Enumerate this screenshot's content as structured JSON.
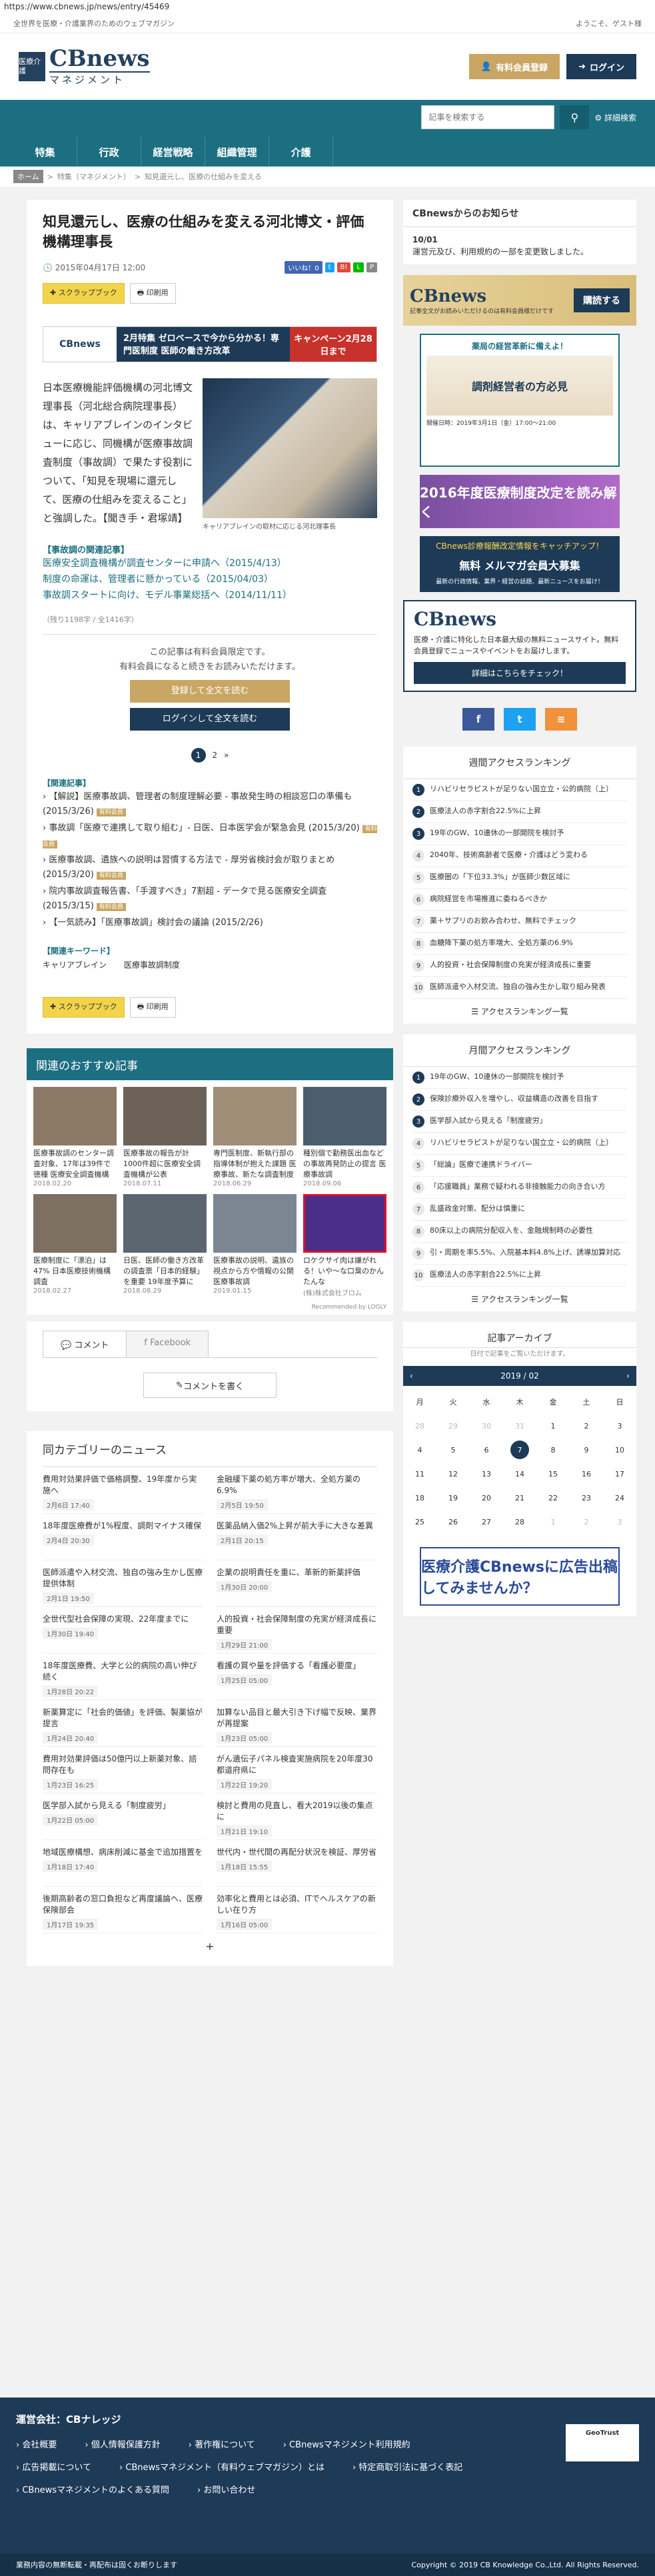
{
  "url": "https://www.cbnews.jp/news/entry/45469",
  "top": {
    "tagline": "全世界を医療・介護業界のためのウェブマガジン",
    "welcome": "ようこそ、ゲスト様"
  },
  "header": {
    "logo_box": "医療介護",
    "logo_main": "CBnews",
    "logo_sub": "マネジメント",
    "member_btn": "有料会員登録",
    "login_btn": "ログイン"
  },
  "nav": {
    "search_placeholder": "記事を検索する",
    "advanced": "詳細検索",
    "items": [
      "特集",
      "行政",
      "経営戦略",
      "組織管理",
      "介護"
    ]
  },
  "crumb": {
    "home": "ホーム",
    "l1": "特集（マネジメント）",
    "l2": "知見還元し、医療の仕組みを変える"
  },
  "article": {
    "title": "知見還元し、医療の仕組みを変える河北博文・評価機構理事長",
    "date": "2015年04月17日 12:00",
    "like": "いいね！0",
    "scrap": "スクラップブック",
    "print": "印刷用",
    "ad": {
      "left": "CBnews",
      "mid": "2月特集 ゼロベースで今から分かる！専門医制度 医師の働き方改革",
      "right": "キャンペーン2月28日まで"
    },
    "lead": "日本医療機能評価機構の河北博文理事長（河北総合病院理事長）は、キャリアブレインのインタビューに応じ、同機構が医療事故調査制度（事故調）で果たす役割について、「知見を現場に還元して、医療の仕組みを変えること」と強調した。【聞き手・君塚靖】",
    "caption": "キャリアブレインの取材に応じる河北理事長",
    "related_head": "【事故調の関連記事】",
    "related": [
      "医療安全調査機構が調査センターに申請へ（2015/4/13）",
      "制度の命運は、管理者に懸かっている（2015/04/03）",
      "事故調スタートに向け、モデル事業総括へ（2014/11/11）"
    ],
    "count": "（残り1198字 / 全1416字）",
    "paywall1": "この記事は有料会員限定です。",
    "paywall2": "有料会員になると続きをお読みいただけます。",
    "register": "登録して全文を読む",
    "login": "ログインして全文を読む",
    "pages": [
      "1",
      "2",
      "»"
    ],
    "kiji_head": "【関連記事】",
    "kiji": [
      "【解説】医療事故調、管理者の制度理解必要 - 事故発生時の相談窓口の準備も (2015/3/26)",
      "事故調「医療で連携して取り組む」- 日医、日本医学会が緊急会見 (2015/3/20)",
      "医療事故調、遺族への説明は習慣する方法で - 厚労省検討会が取りまとめ (2015/3/20)",
      "院内事故調査報告書、「手渡すべき」7割超 - データで見る医療安全調査 (2015/3/15)",
      "【一気読み】「医療事故調」検討会の議論 (2015/2/26)"
    ],
    "tagmark": "有料会員",
    "kw_head": "【関連キーワード】",
    "keywords": [
      "キャリアブレイン",
      "医療事故調制度"
    ]
  },
  "rec": {
    "title": "関連のおすすめ記事",
    "items": [
      {
        "t": "医療事故調のセンター調査対象、17年は39件で徳種 医療安全調査機構 医療事故の調査件数",
        "d": "2018.02.20"
      },
      {
        "t": "医療事故の報告が計1000件超に医療安全調査機構が公表",
        "d": "2018.07.11"
      },
      {
        "t": "専門医制度、新執行部の指導体制が抱えた課題 医療事故、新たな調査制度の公表",
        "d": "2018.06.29"
      },
      {
        "t": "種別個で勤務医出血などの事故再発防止の提言 医療事故調",
        "d": "2018.09.06"
      },
      {
        "t": "医療制度に「漂泊」は47% 日本医療技術機構調査",
        "d": "2018.02.27"
      },
      {
        "t": "日医、医師の働き方改革の調査票「日本的経験」を重要 19年度予算に",
        "d": "2018.08.29"
      },
      {
        "t": "医療事故の説明、遺族の視点から方や情報の公開 医療事故調",
        "d": "2019.01.15"
      },
      {
        "t": "ロケクサイ肉は嫌がれる！いや〜な口臭のかんたんな",
        "d": "(株)株式会社ブロム"
      }
    ],
    "logly": "Recommended by LOGLY"
  },
  "comments": {
    "tab1": "コメント",
    "tab2": "Facebook",
    "write": "コメントを書く"
  },
  "same": {
    "title": "同カテゴリーのニュース",
    "items": [
      {
        "t": "費用対効果評価で価格調整、19年度から実施へ",
        "d": "2月6日 17:40"
      },
      {
        "t": "金融緩下薬の処方率が増大、全処方薬の6.9%",
        "d": "2月5日 19:50"
      },
      {
        "t": "18年度医療費が1%程度、調剤マイナス確保",
        "d": "2月4日 20:30"
      },
      {
        "t": "医薬品納入価2%上昇が前大手に大きな差異",
        "d": "2月1日 20:15"
      },
      {
        "t": "医師派遣や入材交流、独自の強み生かし医療提供体制",
        "d": "2月1日 19:50"
      },
      {
        "t": "企業の説明責任を重に、革新的新薬評価",
        "d": "1月30日 20:00"
      },
      {
        "t": "全世代型社会保障の実現、22年度までに",
        "d": "1月30日 19:40"
      },
      {
        "t": "人的投資・社会保障制度の充実が経済成長に重要",
        "d": "1月29日 21:00"
      },
      {
        "t": "18年度医療費、大学と公的病院の高い伸び続く",
        "d": "1月28日 20:22"
      },
      {
        "t": "看護の質や量を評価する「看護必要度」",
        "d": "1月25日 05:00"
      },
      {
        "t": "新薬算定に「社会的価値」を評価、製薬協が提言",
        "d": "1月24日 20:40"
      },
      {
        "t": "加算ない品目と最大引き下げ幅で反映、業界が再提案",
        "d": "1月23日 05:00"
      },
      {
        "t": "費用対効果評価は50億円以上新薬対象、諮問存在も",
        "d": "1月23日 16:25"
      },
      {
        "t": "がん遺伝子パネル検査実施病院を20年度30都道府県に",
        "d": "1月22日 19:20"
      },
      {
        "t": "医学部入試から見える「制度疲労」",
        "d": "1月22日 05:00"
      },
      {
        "t": "検討と費用の見直し、看大2019以後の集点に",
        "d": "1月21日 19:10"
      },
      {
        "t": "地域医療構想、病床削減に基金で追加措置を",
        "d": "1月18日 17:40"
      },
      {
        "t": "世代内・世代間の再配分状況を検証、厚労省",
        "d": "1月18日 15:55"
      },
      {
        "t": "後期高齢者の窓口負担など再度議論へ、医療保険部会",
        "d": "1月17日 19:35"
      },
      {
        "t": "効率化と費用とは必須、ITでヘルスケアの新しい在り方",
        "d": "1月16日 05:00"
      }
    ],
    "more": "+"
  },
  "side": {
    "notice_title": "CBnewsからのお知らせ",
    "notice_date": "10/01",
    "notice_text": "運営元及び、利用規約の一部を変更致しました。",
    "promo1_logo": "CBnews",
    "promo1_text": "記事全文がお読みいただけるのは有料会員様だけです",
    "promo1_btn": "購読する",
    "promo2_title": "薬局の経営革新に備えよ！",
    "promo2_banner": "調剤経営者の方必見",
    "promo2_info": "開催日時：2019年3月1日（金）17:00～21:00",
    "promo3": "2016年度医療制度改定を読み解く",
    "promo4_a": "CBnews診療報酬改定情報をキャッチアップ！",
    "promo4_b": "無料 メルマガ会員大募集",
    "promo4_c": "最新の行政情報、業界・経営の話題、最新ニュースをお届け！",
    "mm_logo": "CBnews",
    "mm_text": "医療・介護に特化した日本最大級の無料ニュースサイト。無料会員登録でニュースやイベントをお届けします。",
    "mm_btn": "詳細はこちらをチェック！",
    "weekly_title": "週間アクセスランキング",
    "weekly": [
      "リハビリセラピストが足りない国立立・公的病院（上）",
      "医療法人の赤字割合22.5%に上昇",
      "19年のGW、10連休の一部開院を検討予",
      "2040年、技術高齢者で医療・介護はどう変わる",
      "医療圏の「下位33.3%」が医師少数区域に",
      "病院経営を市場推進に委ねるべきか",
      "薬＋サプリのお飲み合わせ、無料でチェック",
      "血糖降下薬の処方率増大、全処方薬の6.9%",
      "人的投資・社会保障制度の充実が経済成長に重要",
      "医師派遣や入材交流、独自の強み生かし取り組み発表"
    ],
    "monthly_title": "月間アクセスランキング",
    "monthly": [
      "19年のGW、10連休の一部開院を検討予",
      "保険診療外収入を増やし、収益構造の改善を目指す",
      "医学部入試から見える「制度疲労」",
      "リハビリセラピストが足りない国立立・公的病院（上）",
      "「総論」医療で連携ドライバー",
      "「応援職員」業務で疑われる非接触能力の向き合い方",
      "乱盛政金対策、配分は慎重に",
      "80床以上の病院分配収入を、金融規制時の必要性",
      "引・周期を率5.5%、入院基本料4.8%上げ、誘導加算対応",
      "医療法人の赤字割合22.5%に上昇"
    ],
    "rank_all": "アクセスランキング一覧",
    "cal_title": "記事アーカイブ",
    "cal_sub": "日付で記事をご覧いただけます。",
    "cal_month": "2019 / 02",
    "cal_days": [
      "月",
      "火",
      "水",
      "木",
      "金",
      "土",
      "日"
    ],
    "cal_cells": [
      "28",
      "29",
      "30",
      "31",
      "1",
      "2",
      "3",
      "4",
      "5",
      "6",
      "7",
      "8",
      "9",
      "10",
      "11",
      "12",
      "13",
      "14",
      "15",
      "16",
      "17",
      "18",
      "19",
      "20",
      "21",
      "22",
      "23",
      "24",
      "25",
      "26",
      "27",
      "28",
      "1",
      "2",
      "3"
    ],
    "ad_text": "医療介護CBnewsに広告出稿してみませんか？"
  },
  "footer": {
    "company": "運営会社：CBナレッジ",
    "links": [
      "会社概要",
      "個人情報保護方針",
      "著作権について",
      "CBnewsマネジメント利用規約",
      "広告掲載について",
      "CBnewsマネジメント（有料ウェブマガジン）とは",
      "特定商取引法に基づく表記",
      "CBnewsマネジメントのよくある質問",
      "お問い合わせ"
    ],
    "trust": "GeoTrust",
    "left": "業務内容の無断転載・再配布は固くお断りします",
    "copy": "Copyright © 2019 CB Knowledge Co.,Ltd. All Rights Reserved."
  },
  "colors": {
    "teal": "#1b6f80",
    "navy": "#1d3a57",
    "gold": "#c9a663"
  }
}
